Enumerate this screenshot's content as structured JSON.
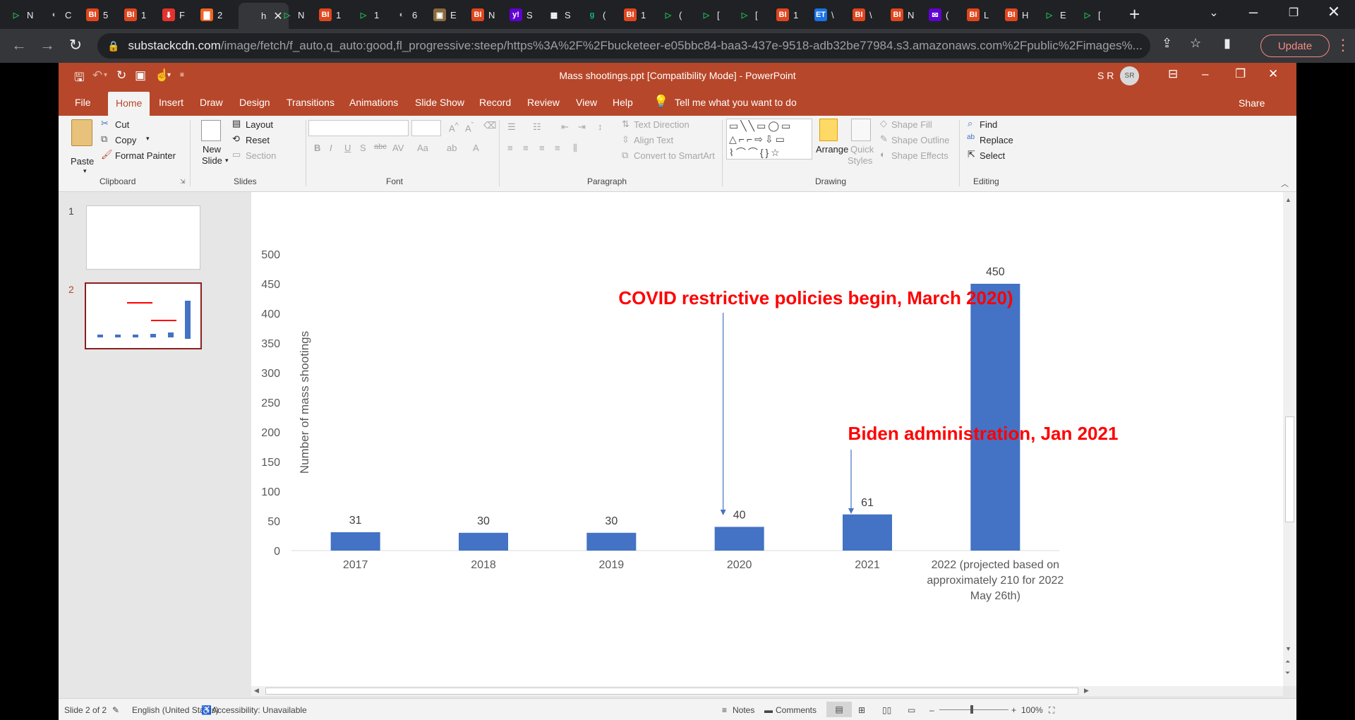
{
  "browser": {
    "tabs": [
      {
        "label": "N",
        "icon": "play-icon",
        "color": "#1db954"
      },
      {
        "label": "C",
        "icon": "globe-icon",
        "color": "#9aa0a6"
      },
      {
        "label": "5",
        "icon": "bi-icon",
        "color": "#e0461e"
      },
      {
        "label": "1",
        "icon": "bi-icon",
        "color": "#e0461e"
      },
      {
        "label": "F",
        "icon": "pin-icon",
        "color": "#e5322d"
      },
      {
        "label": "2",
        "icon": "bookmark-icon",
        "color": "#f26522"
      },
      {
        "label": "h",
        "icon": "blank-icon",
        "color": "#35363a",
        "active": true
      },
      {
        "label": "N",
        "icon": "play-icon",
        "color": "#1db954"
      },
      {
        "label": "1",
        "icon": "bi-icon",
        "color": "#e0461e"
      },
      {
        "label": "1",
        "icon": "play-icon",
        "color": "#1db954"
      },
      {
        "label": "6",
        "icon": "globe-icon",
        "color": "#9aa0a6"
      },
      {
        "label": "E",
        "icon": "photo-icon",
        "color": "#8a6b3e"
      },
      {
        "label": "N",
        "icon": "bi-icon",
        "color": "#e0461e"
      },
      {
        "label": "S",
        "icon": "yahoo-icon",
        "color": "#6001d2"
      },
      {
        "label": "S",
        "icon": "grid-icon",
        "color": "#ffffff"
      },
      {
        "label": "(",
        "icon": "g-icon",
        "color": "#12b886"
      },
      {
        "label": "1",
        "icon": "bi-icon",
        "color": "#e0461e"
      },
      {
        "label": "(",
        "icon": "play-icon",
        "color": "#1db954"
      },
      {
        "label": "[",
        "icon": "play-icon",
        "color": "#1db954"
      },
      {
        "label": "[",
        "icon": "play-icon",
        "color": "#1db954"
      },
      {
        "label": "1",
        "icon": "bi-icon",
        "color": "#e0461e"
      },
      {
        "label": "\\",
        "icon": "et-icon",
        "color": "#1a73e8"
      },
      {
        "label": "\\",
        "icon": "bi-icon",
        "color": "#e0461e"
      },
      {
        "label": "N",
        "icon": "bi-icon",
        "color": "#e0461e"
      },
      {
        "label": "(",
        "icon": "mail-icon",
        "color": "#6001d2"
      },
      {
        "label": "L",
        "icon": "bi-icon",
        "color": "#e0461e"
      },
      {
        "label": "H",
        "icon": "bi-icon",
        "color": "#e0461e"
      },
      {
        "label": "E",
        "icon": "play-icon",
        "color": "#1db954"
      },
      {
        "label": "[",
        "icon": "play-icon",
        "color": "#1db954"
      }
    ],
    "url_host": "substackcdn.com",
    "url_path": "/image/fetch/f_auto,q_auto:good,fl_progressive:steep/https%3A%2F%2Fbucketeer-e05bbc84-baa3-437e-9518-adb32be77984.s3.amazonaws.com%2Fpublic%2Fimages%...",
    "update_label": "Update"
  },
  "ppt": {
    "doc_title": "Mass shootings.ppt [Compatibility Mode]  -  PowerPoint",
    "user_initials": "S R",
    "avatar_text": "SR",
    "menu": [
      "File",
      "Home",
      "Insert",
      "Draw",
      "Design",
      "Transitions",
      "Animations",
      "Slide Show",
      "Record",
      "Review",
      "View",
      "Help"
    ],
    "active_menu": "Home",
    "tell_me": "Tell me what you want to do",
    "share": "Share",
    "ribbon": {
      "paste": "Paste",
      "cut": "Cut",
      "copy": "Copy",
      "format_painter": "Format Painter",
      "clipboard": "Clipboard",
      "new_slide_1": "New",
      "new_slide_2": "Slide",
      "layout": "Layout",
      "reset": "Reset",
      "section": "Section",
      "slides": "Slides",
      "font": "Font",
      "text_direction": "Text Direction",
      "align_text": "Align Text",
      "convert_smartart": "Convert to SmartArt",
      "paragraph": "Paragraph",
      "arrange": "Arrange",
      "quick_styles_1": "Quick",
      "quick_styles_2": "Styles",
      "shape_fill": "Shape Fill",
      "shape_outline": "Shape Outline",
      "shape_effects": "Shape Effects",
      "drawing": "Drawing",
      "find": "Find",
      "replace": "Replace",
      "select": "Select",
      "editing": "Editing"
    },
    "thumbnails": [
      "1",
      "2"
    ],
    "status": {
      "slide": "Slide 2 of 2",
      "language": "English (United States)",
      "accessibility": "Accessibility: Unavailable",
      "notes": "Notes",
      "comments": "Comments",
      "zoom": "100%"
    }
  },
  "chart_data": {
    "type": "bar",
    "categories": [
      "2017",
      "2018",
      "2019",
      "2020",
      "2021",
      "2022 (projected based on approximately 210 for 2022 May 26th)"
    ],
    "values": [
      31,
      30,
      30,
      40,
      61,
      450
    ],
    "ylabel": "Number of mass shootings",
    "ylim": [
      0,
      500
    ],
    "yticks": [
      0,
      50,
      100,
      150,
      200,
      250,
      300,
      350,
      400,
      450,
      500
    ],
    "bar_color": "#4472c4",
    "annotations": [
      {
        "text": "COVID restrictive policies begin, March 2020)",
        "target_category": "2020",
        "color": "#ff0000"
      },
      {
        "text": "Biden administration, Jan 2021",
        "target_category": "2021",
        "color": "#ff0000"
      }
    ],
    "grid": false,
    "legend": "none"
  }
}
